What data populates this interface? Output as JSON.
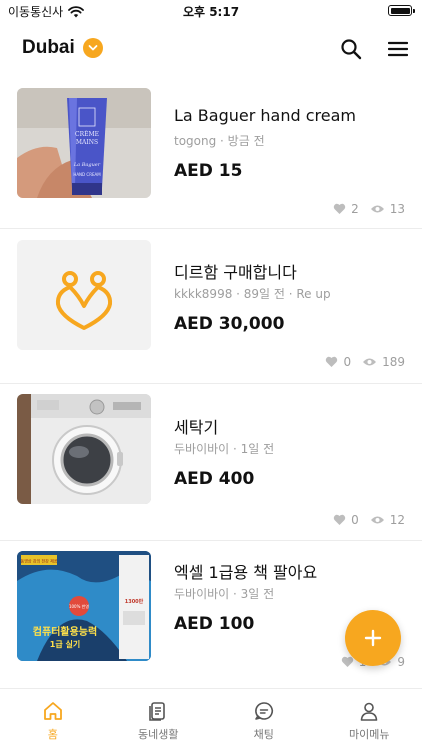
{
  "status_bar": {
    "carrier": "이동통신사",
    "time": "오후 5:17"
  },
  "header": {
    "location": "Dubai"
  },
  "colors": {
    "accent": "#F7A71F",
    "muted": "#9e9e9e"
  },
  "listings": [
    {
      "title": "La Baguer hand cream",
      "meta": "togong · 방금 전",
      "price": "AED 15",
      "likes": "2",
      "views": "13",
      "thumb": "hand-cream-photo",
      "thumb_text": [
        "CRÈME",
        "MAINS",
        "La Baguer",
        "HAND CREAM"
      ]
    },
    {
      "title": "디르함 구매합니다",
      "meta": "kkkk8998 · 89일 전 · Re up",
      "price": "AED 30,000",
      "likes": "0",
      "views": "189",
      "thumb": "placeholder-logo"
    },
    {
      "title": "세탁기",
      "meta": "두바이바이 · 1일 전",
      "price": "AED 400",
      "likes": "0",
      "views": "12",
      "thumb": "washing-machine-photo"
    },
    {
      "title": "엑셀 1급용 책 팔아요",
      "meta": "두바이바이 · 3일 전",
      "price": "AED 100",
      "likes": "1",
      "views": "9",
      "thumb": "book-cover-photo",
      "thumb_text": [
        "동영상 강의 전강 제공",
        "컴퓨터활용능력",
        "1급 실기",
        "100% 반영",
        "1300만"
      ]
    }
  ],
  "tabs": [
    {
      "label": "홈",
      "icon": "home-icon",
      "active": true
    },
    {
      "label": "동네생활",
      "icon": "community-icon",
      "active": false
    },
    {
      "label": "채팅",
      "icon": "chat-icon",
      "active": false
    },
    {
      "label": "마이메뉴",
      "icon": "person-icon",
      "active": false
    }
  ]
}
